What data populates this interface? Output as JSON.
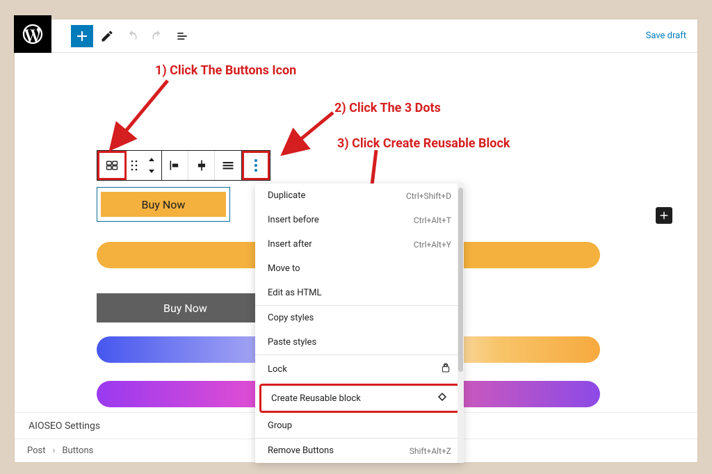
{
  "annotations": {
    "a1": "1) Click The Buttons Icon",
    "a2": "2) Click The 3 Dots",
    "a3": "3) Click Create Reusable Block"
  },
  "top_toolbar": {
    "save_draft": "Save draft"
  },
  "block_toolbar": {
    "buttons_icon": "buttons",
    "drag_handle": "drag",
    "move_up": "up",
    "move_down": "down",
    "align_left": "align-left",
    "align_center": "align-center",
    "justify": "justify",
    "more": "more"
  },
  "buttons": {
    "buy1": "Buy Now",
    "buy2": "Buy Now"
  },
  "menu": {
    "duplicate": {
      "label": "Duplicate",
      "shortcut": "Ctrl+Shift+D"
    },
    "insert_before": {
      "label": "Insert before",
      "shortcut": "Ctrl+Alt+T"
    },
    "insert_after": {
      "label": "Insert after",
      "shortcut": "Ctrl+Alt+Y"
    },
    "move_to": {
      "label": "Move to"
    },
    "edit_html": {
      "label": "Edit as HTML"
    },
    "copy_styles": {
      "label": "Copy styles"
    },
    "paste_styles": {
      "label": "Paste styles"
    },
    "lock": {
      "label": "Lock"
    },
    "create_reusable": {
      "label": "Create Reusable block"
    },
    "group": {
      "label": "Group"
    },
    "remove": {
      "label": "Remove Buttons",
      "shortcut": "Shift+Alt+Z"
    }
  },
  "panels": {
    "aioseo": "AIOSEO Settings"
  },
  "breadcrumbs": {
    "root": "Post",
    "current": "Buttons"
  },
  "colors": {
    "annotation": "#d51e1f",
    "wp_accent": "#007cba",
    "button_fill": "#f4b13e"
  }
}
